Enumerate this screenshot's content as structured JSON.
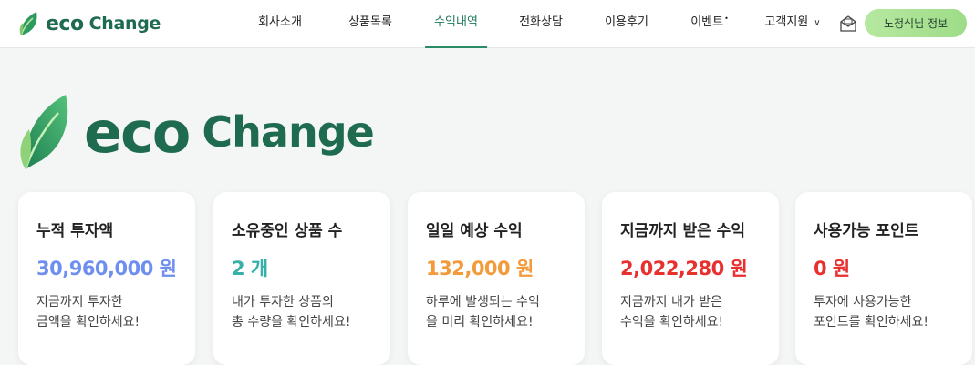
{
  "header": {
    "logo": {
      "eco": "eco",
      "change": "Change"
    },
    "nav": [
      {
        "label": "회사소개",
        "active": false
      },
      {
        "label": "상품목록",
        "active": false
      },
      {
        "label": "수익내역",
        "active": true
      },
      {
        "label": "전화상담",
        "active": false
      },
      {
        "label": "이용후기",
        "active": false
      },
      {
        "label": "이벤트",
        "active": false,
        "badge": "•"
      },
      {
        "label": "고객지원",
        "active": false,
        "dropdown": true
      }
    ],
    "mail_icon": "mail-icon",
    "user_button": "노정식님 정보"
  },
  "hero": {
    "eco": "eco",
    "change": "Change"
  },
  "cards": [
    {
      "title": "누적 투자액",
      "value": "30,960,000 원",
      "desc1": "지금까지 투자한",
      "desc2": "금액을 확인하세요!",
      "color": "#6f8ff0"
    },
    {
      "title": "소유중인 상품 수",
      "value": "2 개",
      "desc1": "내가 투자한 상품의",
      "desc2": "총 수량을 확인하세요!",
      "color": "#36b0a8"
    },
    {
      "title": "일일 예상 수익",
      "value": "132,000 원",
      "desc1": "하루에 발생되는 수익",
      "desc2": "을 미리 확인하세요!",
      "color": "#f39a3a"
    },
    {
      "title": "지금까지 받은 수익",
      "value": "2,022,280 원",
      "desc1": "지금까지 내가 받은",
      "desc2": "수익을 확인하세요!",
      "color": "#e8302f"
    },
    {
      "title": "사용가능 포인트",
      "value": "0 원",
      "desc1": "투자에 사용가능한",
      "desc2": "포인트를 확인하세요!",
      "color": "#e8302f"
    }
  ],
  "colors": {
    "brand": "#1f6b50",
    "accent": "#2d8a67",
    "button": "#a8e292"
  }
}
